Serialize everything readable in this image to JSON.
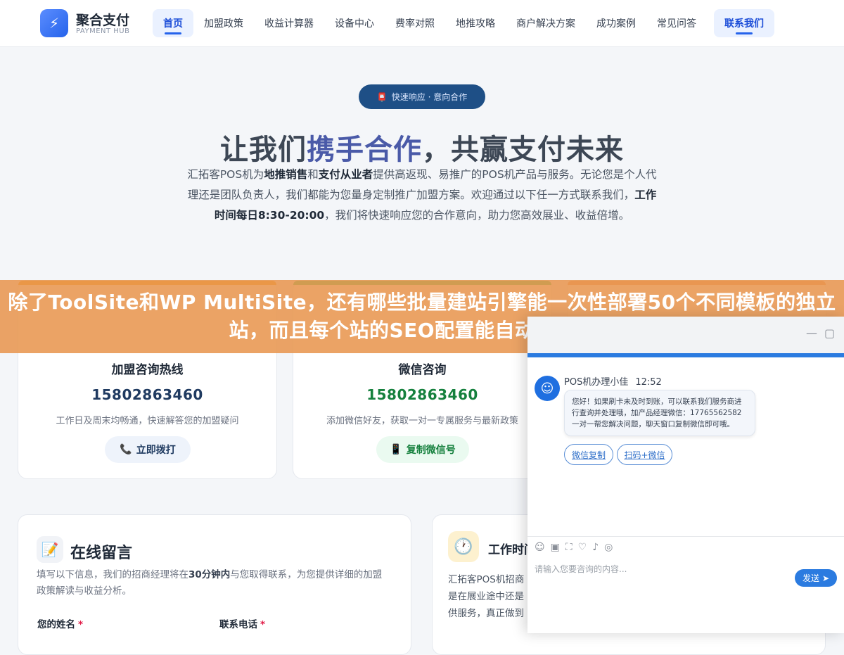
{
  "header": {
    "logo_icon": "lightning-icon",
    "logo_title": "聚合支付",
    "logo_sub": "PAYMENT HUB",
    "nav": [
      "首页",
      "加盟政策",
      "收益计算器",
      "设备中心",
      "费率对照",
      "地推攻略",
      "商户解决方案",
      "成功案例",
      "常见问答"
    ],
    "contact": "联系我们"
  },
  "hero": {
    "pill_icon": "mailbox-icon",
    "pill": "快速响应 · 意向合作",
    "title_pre": "让我们",
    "title_hl": "携手合作",
    "title_post": "，共赢支付未来",
    "desc": {
      "p1": "汇拓客POS机为",
      "b1": "地推销售",
      "p2": "和",
      "b2": "支付从业者",
      "p3": "提供高返现、易推广的POS机产品与服务。无论您是个人代理还是团队负责人，我们都能为您量身定制推广加盟方案。欢迎通过以下任一方式联系我们，",
      "b3": "工作时间每日8:30-20:00",
      "p4": "，我们将快速响应您的合作意向，助力您高效展业、收益倍增。"
    }
  },
  "banner": {
    "text": "除了ToolSite和WP MultiSite，还有哪些批量建站引擎能一次性部署50个不同模板的独立站，而且每个站的SEO配置能自动差异化？"
  },
  "cards": [
    {
      "title": "加盟咨询热线",
      "number": "15802863460",
      "note": "工作日及周末均畅通，快速解答您的加盟疑问",
      "button": "立即拨打",
      "button_icon": "phone-icon",
      "accent": "#f59e0b",
      "number_color": "#1f3a60"
    },
    {
      "title": "微信咨询",
      "number": "15802863460",
      "note": "添加微信好友，获取一对一专属服务与最新政策",
      "button": "复制微信号",
      "button_icon": "mobile-icon",
      "accent": "#22c55e",
      "number_color": "#15803d"
    }
  ],
  "message": {
    "icon": "memo-icon",
    "title": "在线留言",
    "desc_pre": "填写以下信息，我们的招商经理将在",
    "desc_bold": "30分钟内",
    "desc_post": "与您取得联系，为您提供详细的加盟政策解读与收益分析。",
    "name_label": "您的姓名",
    "phone_label": "联系电话",
    "required_mark": "*"
  },
  "worktime": {
    "icon": "clock-icon",
    "title": "工作时间",
    "lines": [
      "汇拓客POS机招商",
      "是在展业途中还是",
      "供服务，真正做到"
    ]
  },
  "chat": {
    "minimize_icon": "minimize-icon",
    "maximize_icon": "maximize-icon",
    "agent_name": "POS机办理小佳",
    "agent_time": "12:52",
    "message": "您好！如果刷卡未及时到账，可以联系我们服务商进行查询并处理哦，加产品经理微信：17765562582 一对一帮您解决问题，聊天窗口复制微信即可哦。",
    "quick_buttons": [
      "微信复制",
      "扫码+微信"
    ],
    "tools": [
      "emoji-icon",
      "image-icon",
      "screenshot-icon",
      "rating-icon",
      "voice-icon",
      "wechat-icon"
    ],
    "input_placeholder": "请输入您要咨询的内容...",
    "send": "发送"
  }
}
